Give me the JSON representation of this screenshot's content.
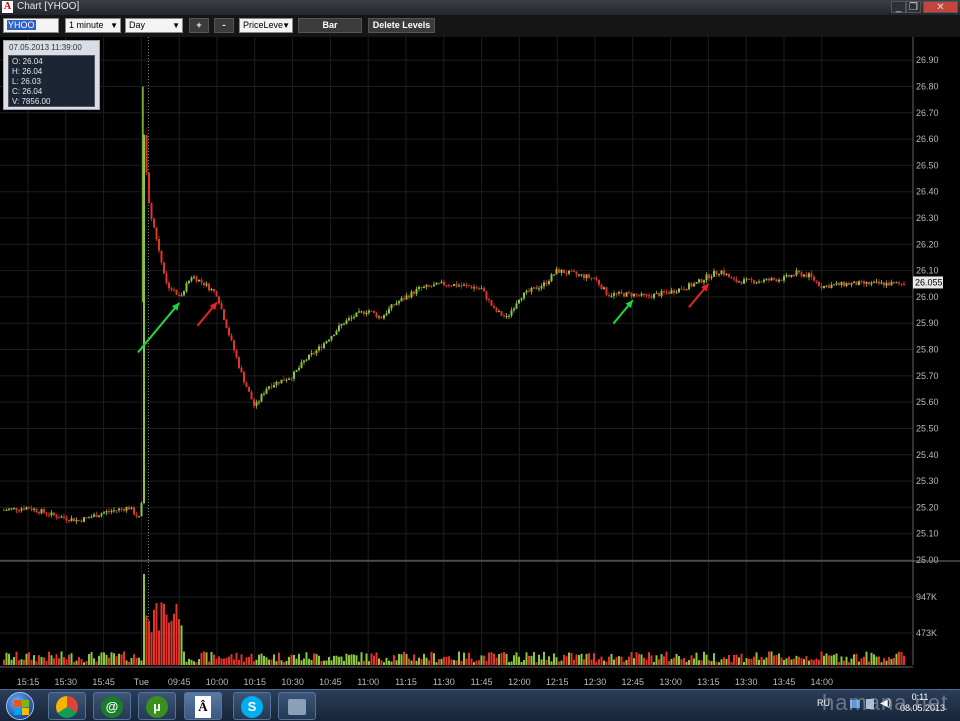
{
  "window": {
    "title": "Chart [YHOO]"
  },
  "toolbar": {
    "symbol": "YHOO",
    "interval": "1 minute",
    "range": "Day",
    "zoom_in": "+",
    "zoom_out": "-",
    "level_mode": "PriceLeve",
    "chart_style": "Bar",
    "delete_levels": "Delete Levels"
  },
  "infobox": {
    "datetime": "07.05.2013 11:39:00",
    "open": "O: 26.04",
    "high": "H: 26.04",
    "low": "L: 26.03",
    "close": "C: 26.04",
    "volume": "V: 7856.00"
  },
  "colors": {
    "up": "#8cc63f",
    "down": "#e0352b",
    "arrow_buy": "#22d43c",
    "arrow_sell": "#e8232a",
    "grid": "#1e1e1e"
  },
  "chart_data": {
    "type": "candlestick",
    "title": "",
    "symbol": "YHOO",
    "price_axis": {
      "ticks": [
        "26.90",
        "26.80",
        "26.70",
        "26.60",
        "26.50",
        "26.40",
        "26.30",
        "26.20",
        "26.10",
        "26.00",
        "25.90",
        "25.80",
        "25.70",
        "25.60",
        "25.50",
        "25.40",
        "25.30",
        "25.20",
        "25.10",
        "25.00"
      ],
      "range": [
        25.0,
        26.95
      ]
    },
    "volume_axis": {
      "ticks": [
        "947K",
        "473K"
      ]
    },
    "time_axis": {
      "ticks": [
        "15:15",
        "15:30",
        "15:45",
        "Tue",
        "09:45",
        "10:00",
        "10:15",
        "10:30",
        "10:45",
        "11:00",
        "11:15",
        "11:30",
        "11:45",
        "12:00",
        "12:15",
        "12:30",
        "12:45",
        "13:00",
        "13:15",
        "13:30",
        "13:45",
        "14:00"
      ]
    },
    "last_price_label": "26.055",
    "price_path": [
      [
        "15:05",
        25.19
      ],
      [
        "15:15",
        25.2
      ],
      [
        "15:25",
        25.17
      ],
      [
        "15:35",
        25.15
      ],
      [
        "15:45",
        25.18
      ],
      [
        "15:55",
        25.2
      ],
      [
        "Tue",
        25.15
      ],
      [
        "09:31",
        26.62
      ],
      [
        "09:33",
        26.35
      ],
      [
        "09:36",
        26.22
      ],
      [
        "09:40",
        26.05
      ],
      [
        "09:45",
        26.0
      ],
      [
        "09:50",
        26.08
      ],
      [
        "09:55",
        26.05
      ],
      [
        "10:00",
        26.01
      ],
      [
        "10:05",
        25.85
      ],
      [
        "10:10",
        25.7
      ],
      [
        "10:15",
        25.58
      ],
      [
        "10:20",
        25.66
      ],
      [
        "10:25",
        25.68
      ],
      [
        "10:30",
        25.7
      ],
      [
        "10:35",
        25.76
      ],
      [
        "10:40",
        25.8
      ],
      [
        "10:45",
        25.85
      ],
      [
        "10:50",
        25.9
      ],
      [
        "10:55",
        25.93
      ],
      [
        "11:00",
        25.95
      ],
      [
        "11:05",
        25.92
      ],
      [
        "11:10",
        25.97
      ],
      [
        "11:15",
        26.0
      ],
      [
        "11:20",
        26.03
      ],
      [
        "11:30",
        26.05
      ],
      [
        "11:40",
        26.04
      ],
      [
        "11:45",
        26.03
      ],
      [
        "11:50",
        25.95
      ],
      [
        "11:55",
        25.92
      ],
      [
        "12:00",
        26.0
      ],
      [
        "12:10",
        26.05
      ],
      [
        "12:15",
        26.1
      ],
      [
        "12:20",
        26.09
      ],
      [
        "12:30",
        26.07
      ],
      [
        "12:35",
        26.01
      ],
      [
        "12:45",
        26.01
      ],
      [
        "12:50",
        26.0
      ],
      [
        "13:00",
        26.02
      ],
      [
        "13:10",
        26.05
      ],
      [
        "13:15",
        26.08
      ],
      [
        "13:20",
        26.1
      ],
      [
        "13:25",
        26.06
      ],
      [
        "13:35",
        26.06
      ],
      [
        "13:45",
        26.07
      ],
      [
        "13:50",
        26.09
      ],
      [
        "13:55",
        26.08
      ],
      [
        "14:00",
        26.04
      ],
      [
        "14:10",
        26.05
      ]
    ],
    "annotations": [
      {
        "type": "arrow",
        "color": "buy",
        "at": "09:45"
      },
      {
        "type": "arrow",
        "color": "sell",
        "at": "10:00"
      },
      {
        "type": "arrow",
        "color": "buy",
        "at": "12:45"
      },
      {
        "type": "arrow",
        "color": "sell",
        "at": "13:15"
      }
    ],
    "grid": true
  },
  "taskbar": {
    "apps": [
      "chrome-icon",
      "icq-icon",
      "utorrent-icon",
      "typography-icon",
      "skype-icon",
      "window-icon"
    ],
    "lang": "RU",
    "time": "0:11",
    "date": "08.05.2013"
  },
  "watermark": "hamana.net"
}
